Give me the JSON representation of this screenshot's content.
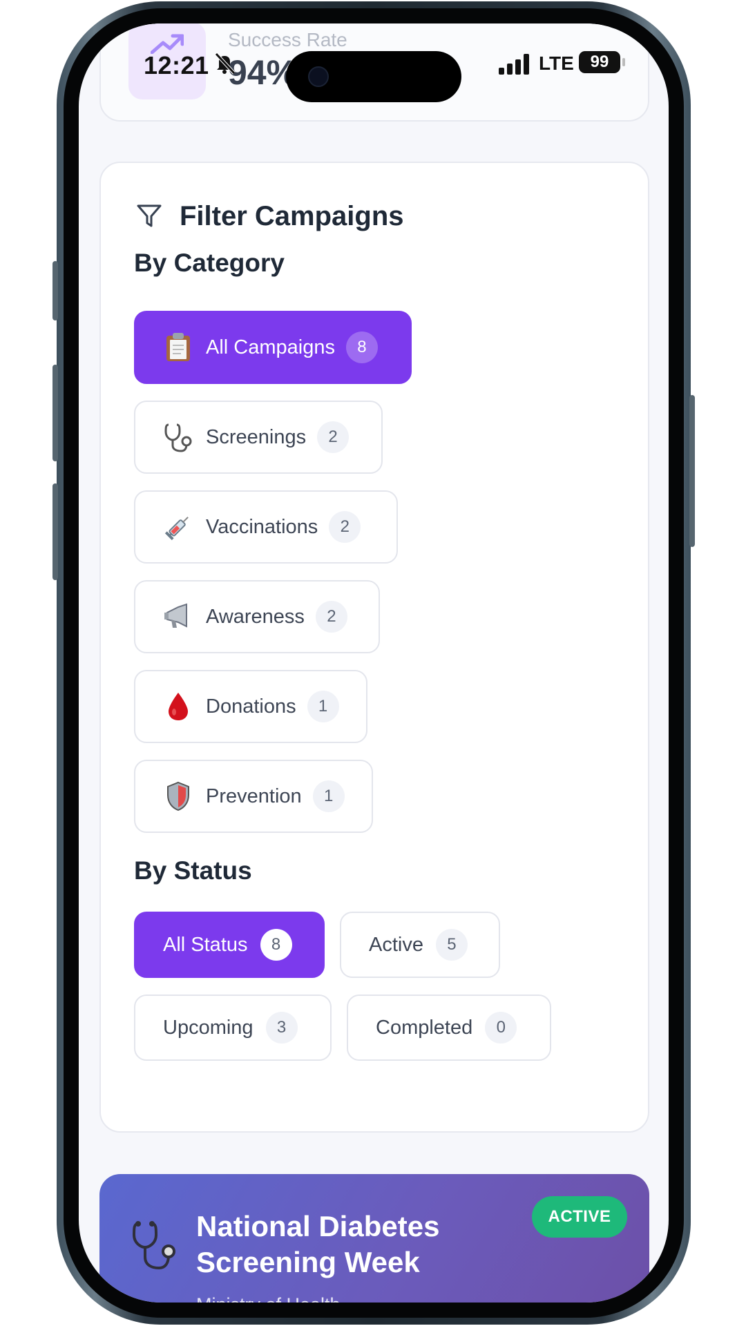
{
  "status_bar": {
    "time": "12:21",
    "network": "LTE",
    "battery": "99"
  },
  "stats": {
    "label": "Success Rate",
    "value": "94%"
  },
  "filter": {
    "title": "Filter Campaigns",
    "category_heading": "By Category",
    "categories": [
      {
        "icon": "clipboard-icon",
        "label": "All Campaigns",
        "count": "8",
        "selected": true
      },
      {
        "icon": "stethoscope-icon",
        "label": "Screenings",
        "count": "2",
        "selected": false
      },
      {
        "icon": "syringe-icon",
        "label": "Vaccinations",
        "count": "2",
        "selected": false
      },
      {
        "icon": "megaphone-icon",
        "label": "Awareness",
        "count": "2",
        "selected": false
      },
      {
        "icon": "blood-drop-icon",
        "label": "Donations",
        "count": "1",
        "selected": false
      },
      {
        "icon": "shield-icon",
        "label": "Prevention",
        "count": "1",
        "selected": false
      }
    ],
    "status_heading": "By Status",
    "statuses": [
      {
        "label": "All Status",
        "count": "8",
        "selected": true
      },
      {
        "label": "Active",
        "count": "5",
        "selected": false
      },
      {
        "label": "Upcoming",
        "count": "3",
        "selected": false
      },
      {
        "label": "Completed",
        "count": "0",
        "selected": false
      }
    ]
  },
  "campaign": {
    "icon": "stethoscope-icon",
    "title": "National Diabetes Screening Week",
    "organization": "Ministry of Health",
    "badge": "ACTIVE"
  },
  "colors": {
    "accent": "#7c3aed",
    "active_badge": "#1eb97a",
    "card_gradient_start": "#5a68cf",
    "card_gradient_end": "#6c4fa6"
  }
}
